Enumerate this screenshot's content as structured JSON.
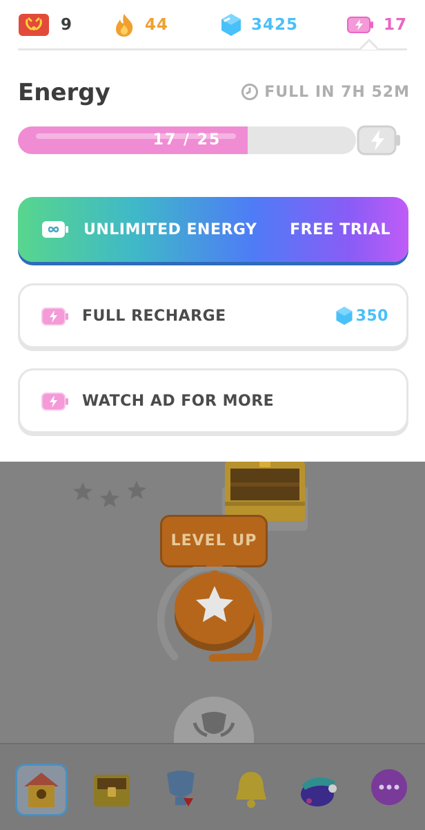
{
  "topbar": {
    "league_count": "9",
    "streak": "44",
    "gems": "3425",
    "energy": "17"
  },
  "energy_panel": {
    "title": "Energy",
    "full_in": "FULL IN 7H 52M",
    "progress_text": "17 / 25",
    "current": 17,
    "max": 25
  },
  "options": [
    {
      "label": "UNLIMITED ENERGY",
      "right": "FREE TRIAL"
    },
    {
      "label": "FULL RECHARGE",
      "right": "350"
    },
    {
      "label": "WATCH AD FOR MORE",
      "right": ""
    }
  ],
  "map": {
    "level_up_label": "LEVEL UP"
  },
  "colors": {
    "energy_pink": "#f08cd3",
    "gem_blue": "#49c0f8",
    "streak_orange": "#f0a030",
    "text_dark": "#3c3c3c",
    "muted_gray": "#afafaf"
  },
  "icons": {
    "league": "laurel-shield-icon",
    "streak": "flame-icon",
    "gems": "gem-icon",
    "energy": "battery-bolt-icon",
    "timer": "clock-icon",
    "unlimited": "infinity-battery-icon",
    "nav": [
      "home-icon",
      "chest-icon",
      "trophy-icon",
      "bell-icon",
      "character-icon",
      "more-icon"
    ]
  }
}
